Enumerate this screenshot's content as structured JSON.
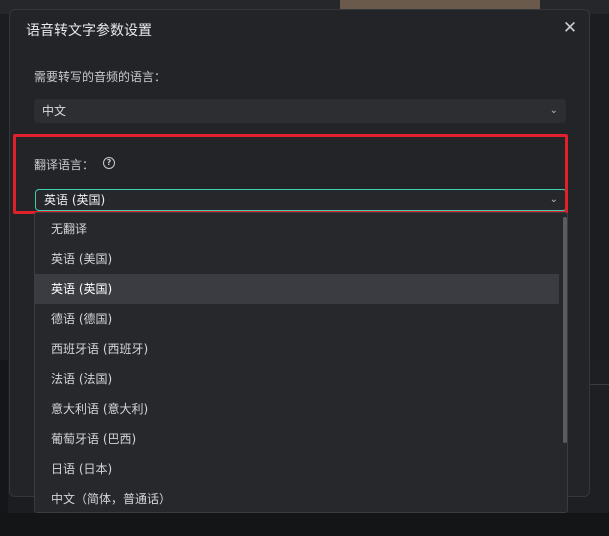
{
  "dialog": {
    "title": "语音转文字参数设置",
    "close_icon": "close-icon",
    "source_language": {
      "label": "需要转写的音频的语言：",
      "selected": "中文"
    },
    "translate_language": {
      "label": "翻译语言：",
      "help_icon": "help-circle-icon",
      "selected": "英语 (英国)",
      "options": [
        "无翻译",
        "英语 (美国)",
        "英语 (英国)",
        "德语 (德国)",
        "西班牙语 (西班牙)",
        "法语 (法国)",
        "意大利语 (意大利)",
        "葡萄牙语 (巴西)",
        "日语 (日本)",
        "中文（简体，普通话）"
      ],
      "selected_index": 2
    }
  },
  "colors": {
    "accent_focus": "#3fcfae",
    "highlight_box": "#e0202a",
    "dialog_bg": "#222428"
  }
}
